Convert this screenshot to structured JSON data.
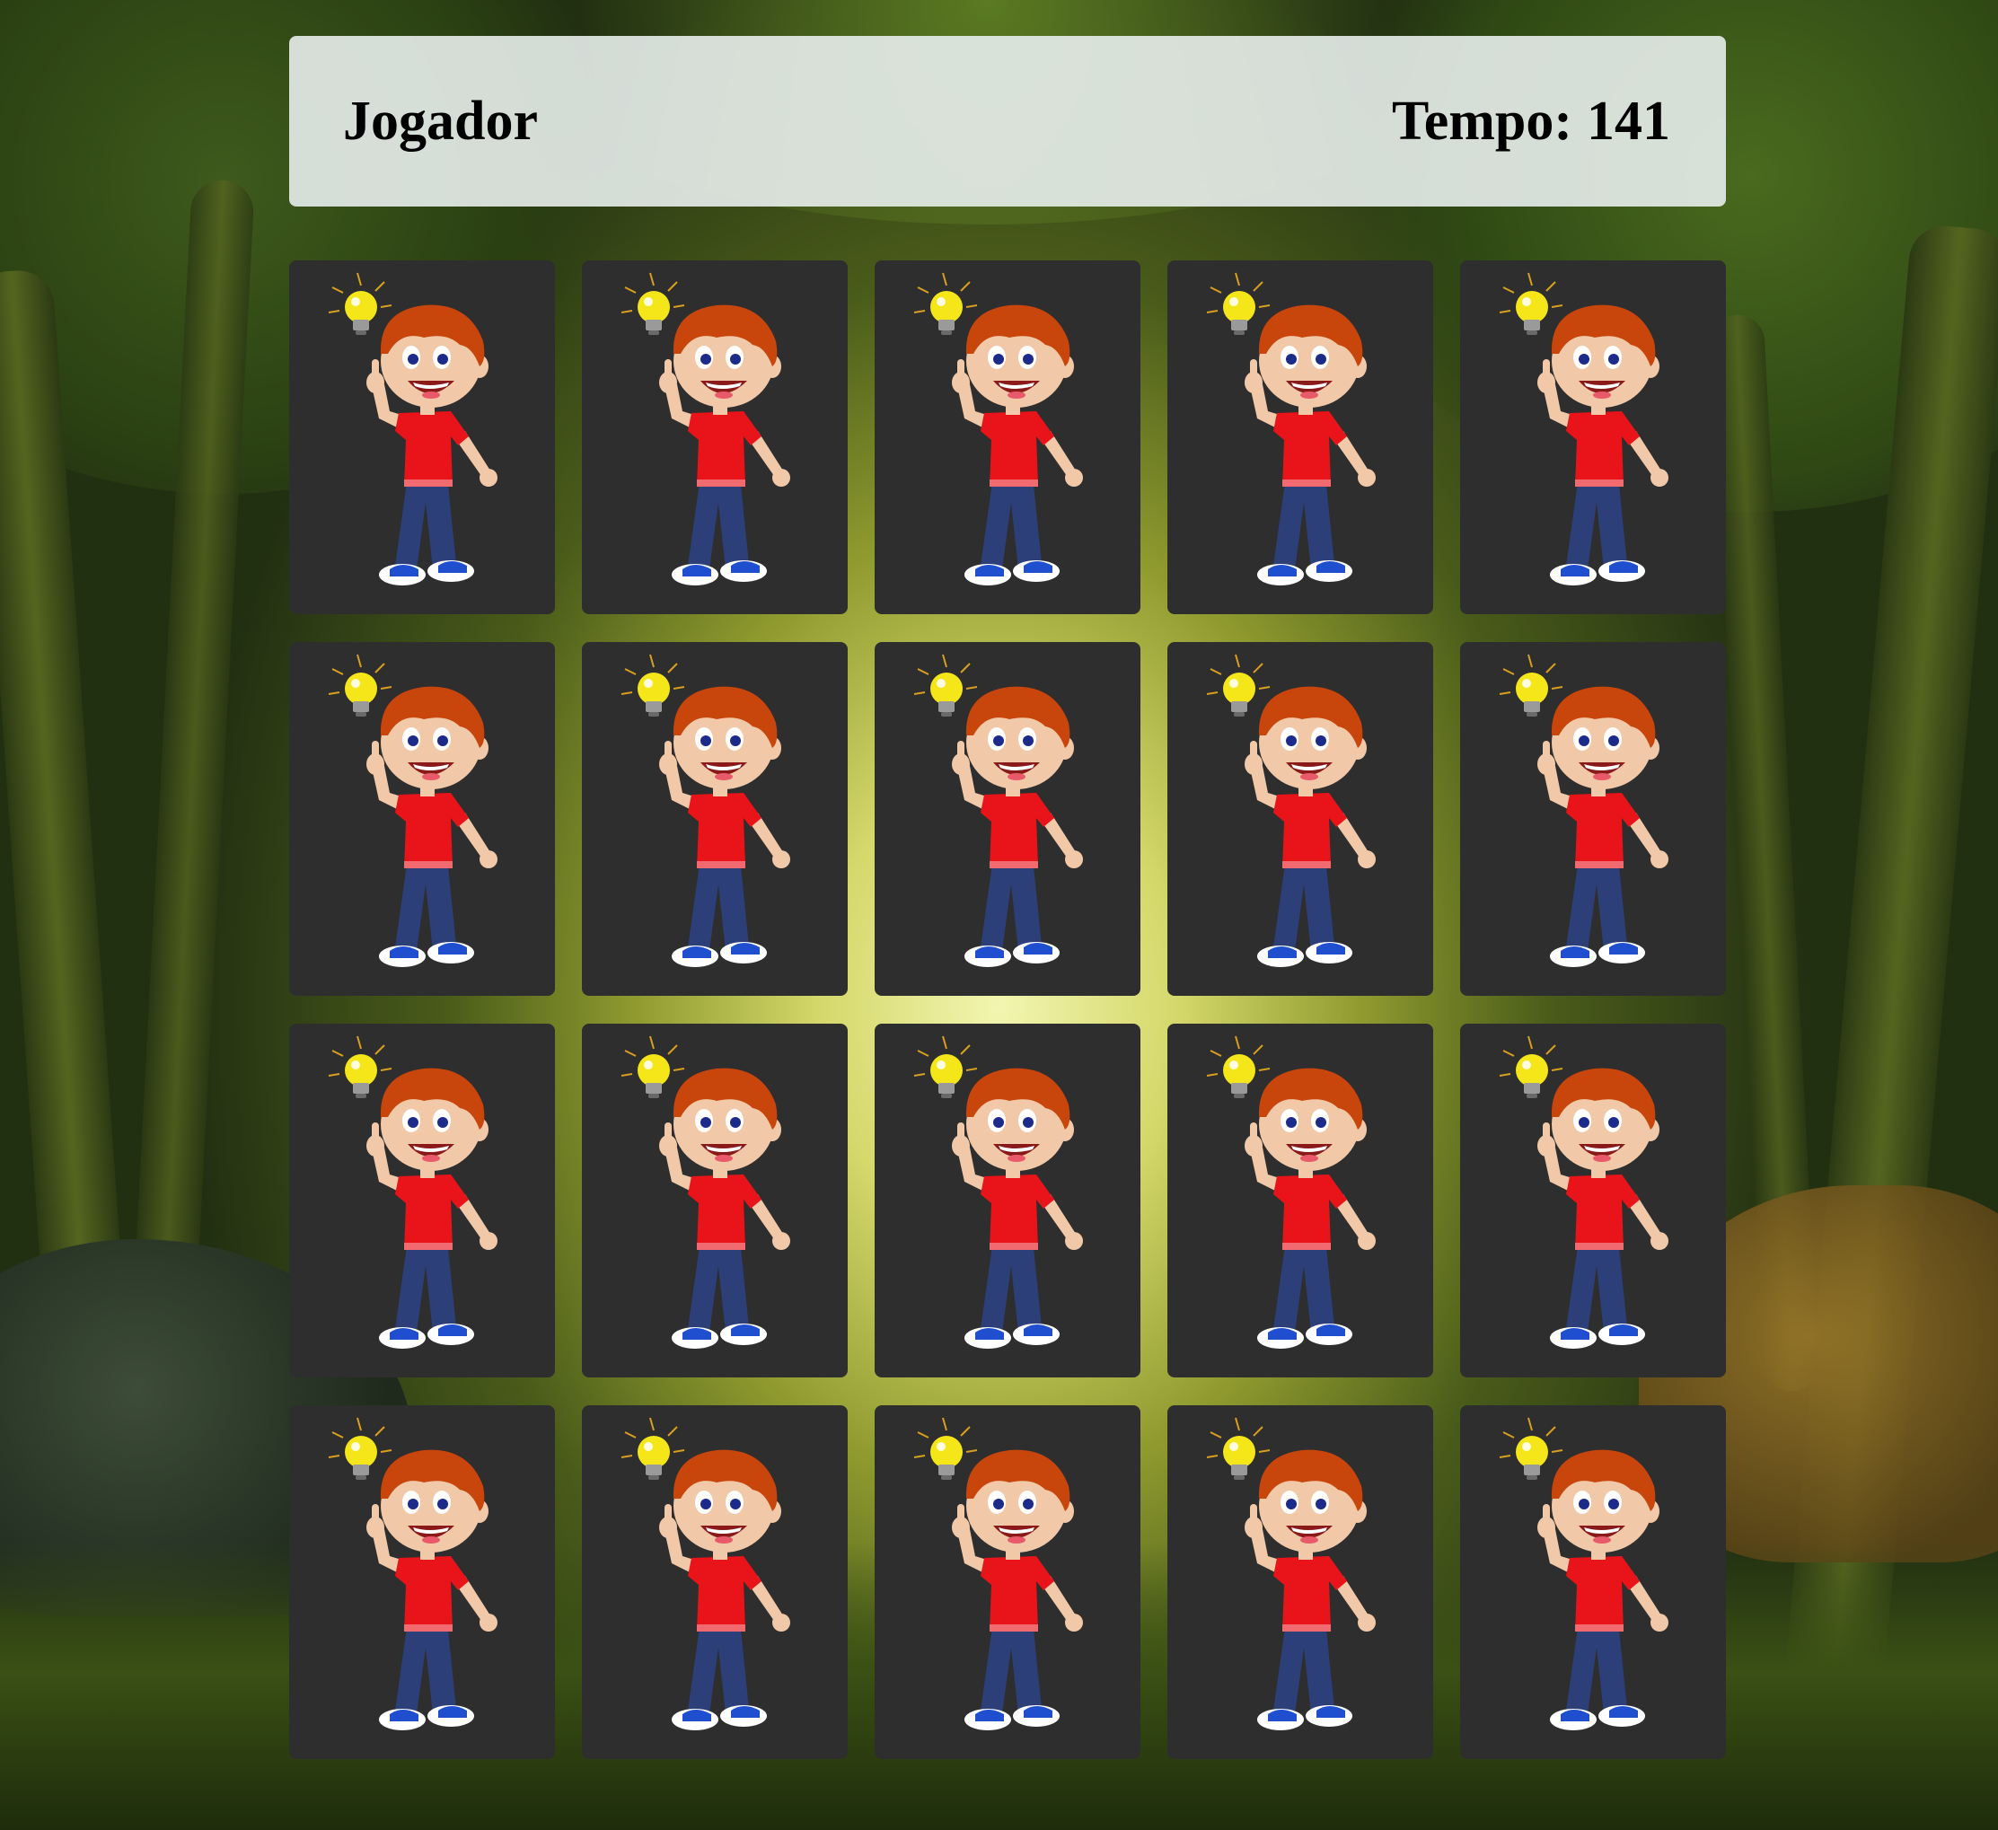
{
  "header": {
    "player_label": "Jogador",
    "time_label": "Tempo:",
    "time_value": "141"
  },
  "board": {
    "rows": 4,
    "columns": 5,
    "card_back_icon": "boy-with-lightbulb-icon",
    "cards": [
      {
        "state": "face-down"
      },
      {
        "state": "face-down"
      },
      {
        "state": "face-down"
      },
      {
        "state": "face-down"
      },
      {
        "state": "face-down"
      },
      {
        "state": "face-down"
      },
      {
        "state": "face-down"
      },
      {
        "state": "face-down"
      },
      {
        "state": "face-down"
      },
      {
        "state": "face-down"
      },
      {
        "state": "face-down"
      },
      {
        "state": "face-down"
      },
      {
        "state": "face-down"
      },
      {
        "state": "face-down"
      },
      {
        "state": "face-down"
      },
      {
        "state": "face-down"
      },
      {
        "state": "face-down"
      },
      {
        "state": "face-down"
      },
      {
        "state": "face-down"
      },
      {
        "state": "face-down"
      }
    ]
  },
  "colors": {
    "card_back": "#2e2e2e",
    "header_bg": "#e8eeec",
    "shirt": "#e8141a",
    "hair": "#c8450c",
    "jeans": "#2c3f78",
    "bulb": "#f5e61a"
  }
}
